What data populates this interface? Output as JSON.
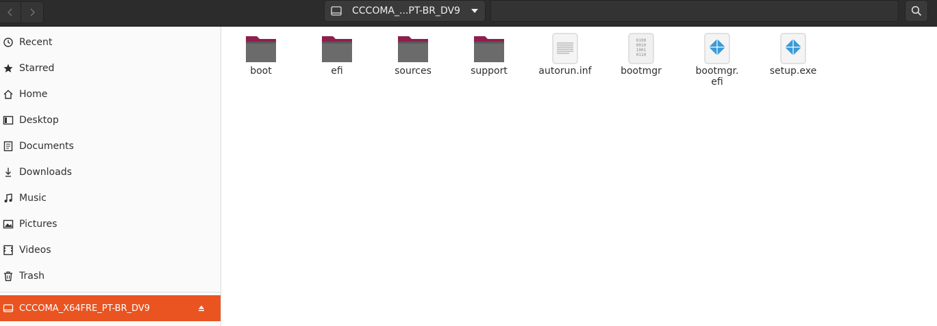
{
  "header": {
    "path_label": "CCCOMA_...PT-BR_DV9"
  },
  "sidebar": {
    "items": [
      {
        "label": "Recent",
        "icon": "clock-icon"
      },
      {
        "label": "Starred",
        "icon": "star-icon"
      },
      {
        "label": "Home",
        "icon": "home-icon"
      },
      {
        "label": "Desktop",
        "icon": "desktop-icon"
      },
      {
        "label": "Documents",
        "icon": "document-icon"
      },
      {
        "label": "Downloads",
        "icon": "download-icon"
      },
      {
        "label": "Music",
        "icon": "music-icon"
      },
      {
        "label": "Pictures",
        "icon": "picture-icon"
      },
      {
        "label": "Videos",
        "icon": "video-icon"
      },
      {
        "label": "Trash",
        "icon": "trash-icon"
      }
    ],
    "device": {
      "label": "CCCOMA_X64FRE_PT-BR_DV9",
      "icon": "drive-icon"
    }
  },
  "files": [
    {
      "name": "boot",
      "type": "folder"
    },
    {
      "name": "efi",
      "type": "folder"
    },
    {
      "name": "sources",
      "type": "folder"
    },
    {
      "name": "support",
      "type": "folder"
    },
    {
      "name": "autorun.inf",
      "type": "text"
    },
    {
      "name": "bootmgr",
      "type": "binary"
    },
    {
      "name": "bootmgr.\nefi",
      "type": "executable"
    },
    {
      "name": "setup.exe",
      "type": "executable"
    }
  ],
  "colors": {
    "accent": "#e95420",
    "folder_top": "#8e1f4e",
    "folder_body": "#6b6b6b",
    "exe_blue": "#3a9ad9"
  }
}
